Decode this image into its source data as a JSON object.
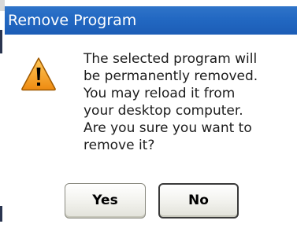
{
  "dialog": {
    "title": "Remove Program",
    "icon": "warning-icon",
    "message_lines": [
      "The selected program will",
      "be permanently removed.",
      "You may reload it from",
      "your desktop computer.",
      "Are you sure you want to",
      "remove it?"
    ],
    "buttons": {
      "yes_label": "Yes",
      "no_label": "No"
    }
  },
  "colors": {
    "titlebar": "#2268c2",
    "title_text": "#ffffff",
    "warning_fill": "#f39c1e",
    "warning_mark": "#000000"
  }
}
